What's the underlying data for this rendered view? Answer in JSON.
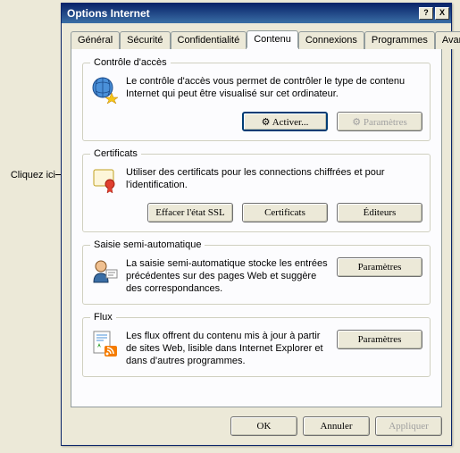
{
  "annotation": "Cliquez ici",
  "window": {
    "title": "Options Internet",
    "help": "?",
    "close": "X"
  },
  "tabs": [
    "Général",
    "Sécurité",
    "Confidentialité",
    "Contenu",
    "Connexions",
    "Programmes",
    "Avancés"
  ],
  "active_tab": "Contenu",
  "groups": {
    "access": {
      "legend": "Contrôle d'accès",
      "desc": "Le contrôle d'accès vous permet de contrôler le type de contenu Internet qui peut être visualisé sur cet ordinateur.",
      "btn_enable": "Activer...",
      "btn_settings": "Paramètres"
    },
    "certs": {
      "legend": "Certificats",
      "desc": "Utiliser des certificats pour les connections chiffrées et pour l'identification.",
      "btn_clear_ssl": "Effacer l'état SSL",
      "btn_certs": "Certificats",
      "btn_publishers": "Éditeurs"
    },
    "autocomplete": {
      "legend": "Saisie semi-automatique",
      "desc": "La saisie semi-automatique stocke les entrées précédentes sur des pages Web et suggère des correspondances.",
      "btn_settings": "Paramètres"
    },
    "feeds": {
      "legend": "Flux",
      "desc": "Les flux offrent du contenu mis à jour à partir de sites Web, lisible dans Internet Explorer et dans d'autres programmes.",
      "btn_settings": "Paramètres"
    }
  },
  "buttons": {
    "ok": "OK",
    "cancel": "Annuler",
    "apply": "Appliquer"
  },
  "icons": {
    "gear_prefix": "⚙"
  }
}
